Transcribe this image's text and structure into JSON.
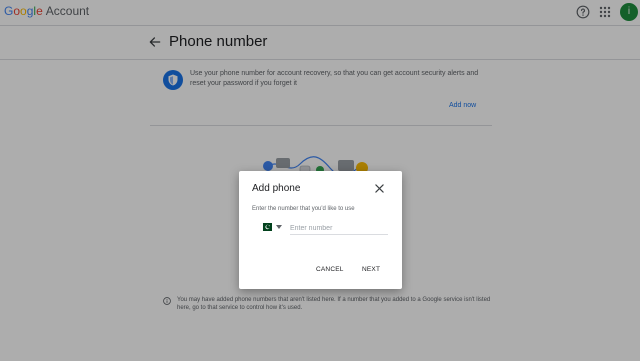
{
  "header": {
    "brand_letters": [
      "G",
      "o",
      "o",
      "g",
      "l",
      "e"
    ],
    "account_label": "Account",
    "avatar_initial": "i"
  },
  "page": {
    "title": "Phone number",
    "info_text": "Use your phone number for account recovery, so that you can get account security alerts and reset your password if you forget it",
    "add_now_label": "Add now",
    "footer_text": "You may have added phone numbers that aren't listed here. If a number that you added to a Google service isn't listed here, go to that service to control how it's used."
  },
  "dialog": {
    "title": "Add phone",
    "subtitle": "Enter the number that you'd like to use",
    "phone_placeholder": "Enter number",
    "phone_value": "",
    "country_icon": "pakistan-flag-icon",
    "cancel_label": "CANCEL",
    "next_label": "NEXT"
  },
  "colors": {
    "accent": "#1a73e8",
    "avatar": "#1e8e3e",
    "scrim": "rgba(0,0,0,0.32)"
  }
}
